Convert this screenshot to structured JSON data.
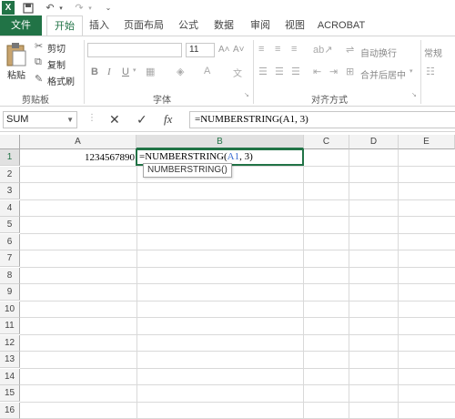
{
  "colors": {
    "accent": "#217346",
    "file_tab": "#217346",
    "ref_blue": "#3c6fd1"
  },
  "qat": {
    "excel_icon": "excel-logo-icon",
    "save": "save-icon",
    "undo": "undo-icon",
    "redo": "redo-icon",
    "customize": "customize-qat-icon"
  },
  "tabs": [
    "文件",
    "开始",
    "插入",
    "页面布局",
    "公式",
    "数据",
    "审阅",
    "视图",
    "ACROBAT"
  ],
  "active_tab": "开始",
  "ribbon": {
    "clipboard": {
      "paste": "粘贴",
      "cut": "剪切",
      "copy": "复制",
      "format_painter": "格式刷",
      "group_label": "剪贴板"
    },
    "font": {
      "font_name": "",
      "font_size": "11",
      "group_label": "字体",
      "bold": "B",
      "italic": "I",
      "underline": "U"
    },
    "alignment": {
      "wrap_text": "自动换行",
      "merge_center": "合并后居中",
      "group_label": "对齐方式"
    },
    "number": {
      "format": "常规"
    }
  },
  "formula_bar": {
    "name_box": "SUM",
    "cancel": "✕",
    "enter": "✓",
    "fx": "fx",
    "content": "=NUMBERSTRING(A1, 3)"
  },
  "grid": {
    "columns": [
      "A",
      "B",
      "C",
      "D",
      "E"
    ],
    "selected_column": "B",
    "rows": [
      "1",
      "2",
      "3",
      "4",
      "5",
      "6",
      "7",
      "8",
      "9",
      "10",
      "11",
      "12",
      "13",
      "14",
      "15",
      "16"
    ],
    "selected_row": "1",
    "cells": {
      "A1": "1234567890",
      "B1_prefix": "=NUMBERSTRING(",
      "B1_ref": "A1",
      "B1_suffix": ", 3)"
    }
  },
  "tooltip": "NUMBERSTRING()"
}
